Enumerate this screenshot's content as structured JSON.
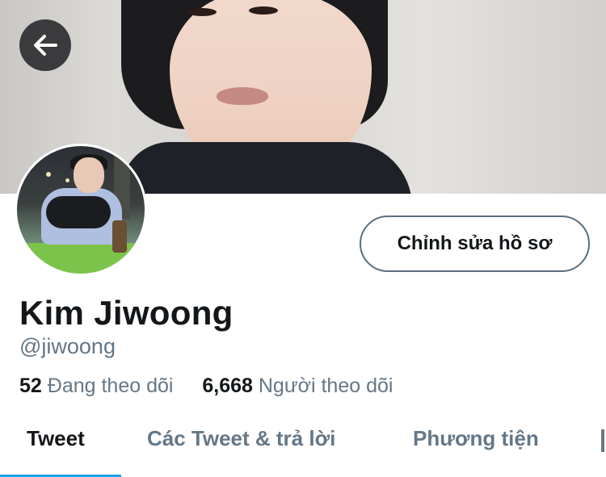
{
  "profile": {
    "name": "Kim Jiwoong",
    "handle": "@jiwoong",
    "following_count": "52",
    "following_label": "Đang theo dõi",
    "followers_count": "6,668",
    "followers_label": "Người theo dõi"
  },
  "actions": {
    "edit_profile_label": "Chỉnh sửa hồ sơ"
  },
  "tabs": [
    {
      "label": "Tweet",
      "active": true
    },
    {
      "label": "Các Tweet & trả lời",
      "active": false
    },
    {
      "label": "Phương tiện",
      "active": false
    }
  ],
  "colors": {
    "accent": "#1da1f2",
    "secondary_text": "#657786",
    "primary_text": "#14171a"
  },
  "icons": {
    "back": "arrow-left-icon"
  }
}
